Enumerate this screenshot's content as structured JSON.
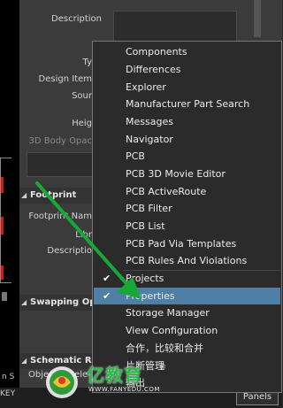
{
  "panel": {
    "labels": {
      "description": "Description",
      "type": "Ty",
      "design_item": "Design Item",
      "source": "Sour",
      "height": "Heig",
      "body_opacity": "3D Body Opac"
    },
    "sections": {
      "footprint": "Footprint",
      "footprint_name": "Footprint Nam",
      "library": "Libr",
      "fp_description": "Descriptio",
      "swapping": "Swapping Opt",
      "schematic": "Schematic Ref",
      "status_text": "Object is sele"
    }
  },
  "context_menu": {
    "items": [
      {
        "label": "Components",
        "checked": false
      },
      {
        "label": "Differences",
        "checked": false
      },
      {
        "label": "Explorer",
        "checked": false
      },
      {
        "label": "Manufacturer Part Search",
        "checked": false
      },
      {
        "label": "Messages",
        "checked": false
      },
      {
        "label": "Navigator",
        "checked": false
      },
      {
        "label": "PCB",
        "checked": false
      },
      {
        "label": "PCB 3D Movie Editor",
        "checked": false
      },
      {
        "label": "PCB ActiveRoute",
        "checked": false
      },
      {
        "label": "PCB Filter",
        "checked": false
      },
      {
        "label": "PCB List",
        "checked": false
      },
      {
        "label": "PCB Pad Via Templates",
        "checked": false
      },
      {
        "label": "PCB Rules And Violations",
        "checked": false
      },
      {
        "label": "Projects",
        "checked": true
      },
      {
        "label": "Properties",
        "checked": true,
        "highlighted": true
      },
      {
        "label": "Storage Manager",
        "checked": false
      },
      {
        "label": "View Configuration",
        "checked": false
      },
      {
        "label": "合作，比较和合并",
        "checked": false
      },
      {
        "label": "片断管理",
        "checked": false
      },
      {
        "label": "输出",
        "checked": false
      }
    ],
    "check_glyph": "✔"
  },
  "bottom": {
    "left_text": "KEY",
    "left_text2": "n S",
    "panels_label": "Panels"
  },
  "watermark": {
    "brand": "亿教育",
    "url": "WWW.FANYEDU.COM",
    "reg": "®"
  },
  "colors": {
    "highlight": "#4f7fa4",
    "arrow": "#18a838",
    "menu_bg": "#2b2b2b",
    "panel_bg": "#3b3b3b"
  },
  "icons": {
    "arrow": "green-pointer-arrow-icon",
    "watermark_logo": "fanyedu-logo-icon"
  }
}
